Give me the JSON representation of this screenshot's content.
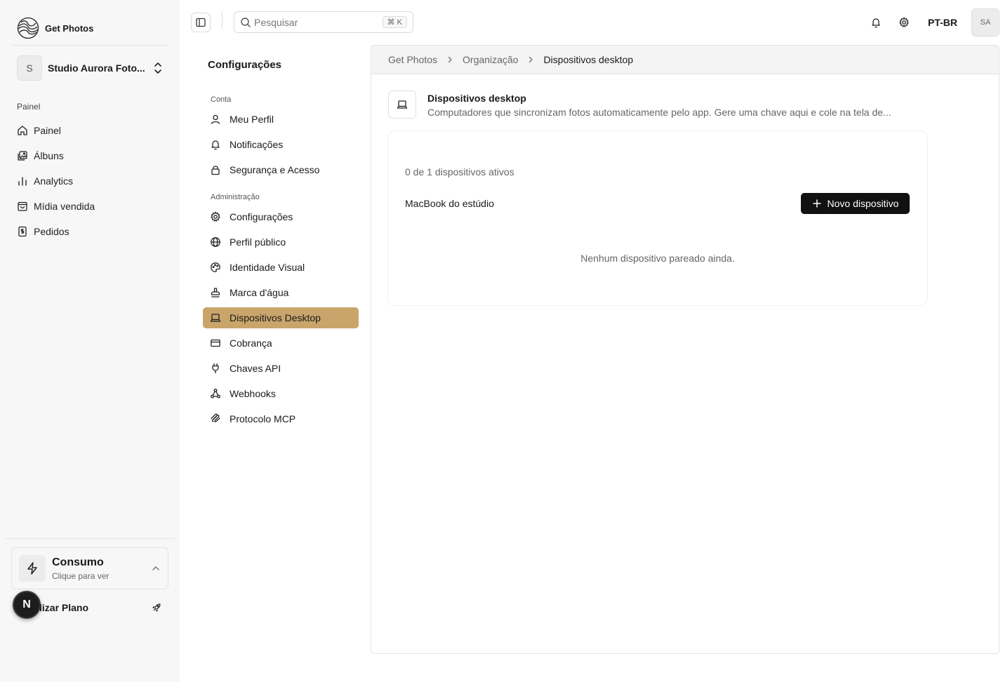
{
  "app": {
    "name": "Get Photos"
  },
  "org": {
    "initial": "S",
    "name": "Studio Aurora Foto..."
  },
  "main_nav": {
    "section_label": "Painel",
    "items": [
      {
        "label": "Painel",
        "icon": "home-icon"
      },
      {
        "label": "Álbuns",
        "icon": "images-icon"
      },
      {
        "label": "Analytics",
        "icon": "bar-chart-icon"
      },
      {
        "label": "Mídia vendida",
        "icon": "shopping-bag-icon"
      },
      {
        "label": "Pedidos",
        "icon": "receipt-icon"
      }
    ]
  },
  "consumo": {
    "title": "Consumo",
    "subtitle": "Clique para ver"
  },
  "upgrade": {
    "label": "lizar Plano"
  },
  "floating_button": {
    "label": "N"
  },
  "topbar": {
    "search_placeholder": "Pesquisar",
    "search_shortcut": "⌘ K",
    "language": "PT-BR",
    "user_initials": "SA"
  },
  "settings": {
    "title": "Configurações",
    "groups": [
      {
        "label": "Conta",
        "items": [
          {
            "label": "Meu Perfil",
            "icon": "user-icon"
          },
          {
            "label": "Notificações",
            "icon": "bell-icon"
          },
          {
            "label": "Segurança e Acesso",
            "icon": "lock-icon"
          }
        ]
      },
      {
        "label": "Administração",
        "items": [
          {
            "label": "Configurações",
            "icon": "gear-icon"
          },
          {
            "label": "Perfil público",
            "icon": "globe-icon"
          },
          {
            "label": "Identidade Visual",
            "icon": "palette-icon"
          },
          {
            "label": "Marca d'água",
            "icon": "stamp-icon"
          },
          {
            "label": "Dispositivos Desktop",
            "icon": "laptop-icon",
            "active": true
          },
          {
            "label": "Cobrança",
            "icon": "credit-card-icon"
          },
          {
            "label": "Chaves API",
            "icon": "plug-icon"
          },
          {
            "label": "Webhooks",
            "icon": "webhook-icon"
          },
          {
            "label": "Protocolo MCP",
            "icon": "mcp-icon"
          }
        ]
      }
    ]
  },
  "breadcrumb": [
    "Get Photos",
    "Organização",
    "Dispositivos desktop"
  ],
  "page": {
    "title": "Dispositivos desktop",
    "description": "Computadores que sincronizam fotos automaticamente pelo app. Gere uma chave aqui e cole na tela de...",
    "device_count": "0 de 1 dispositivos ativos",
    "device_name": "MacBook do estúdio",
    "new_device_label": "Novo dispositivo",
    "empty_message": "Nenhum dispositivo pareado ainda."
  },
  "colors": {
    "accent": "#c9a56c",
    "primary_button": "#111111",
    "sidebar_bg": "#f7f7f7"
  }
}
